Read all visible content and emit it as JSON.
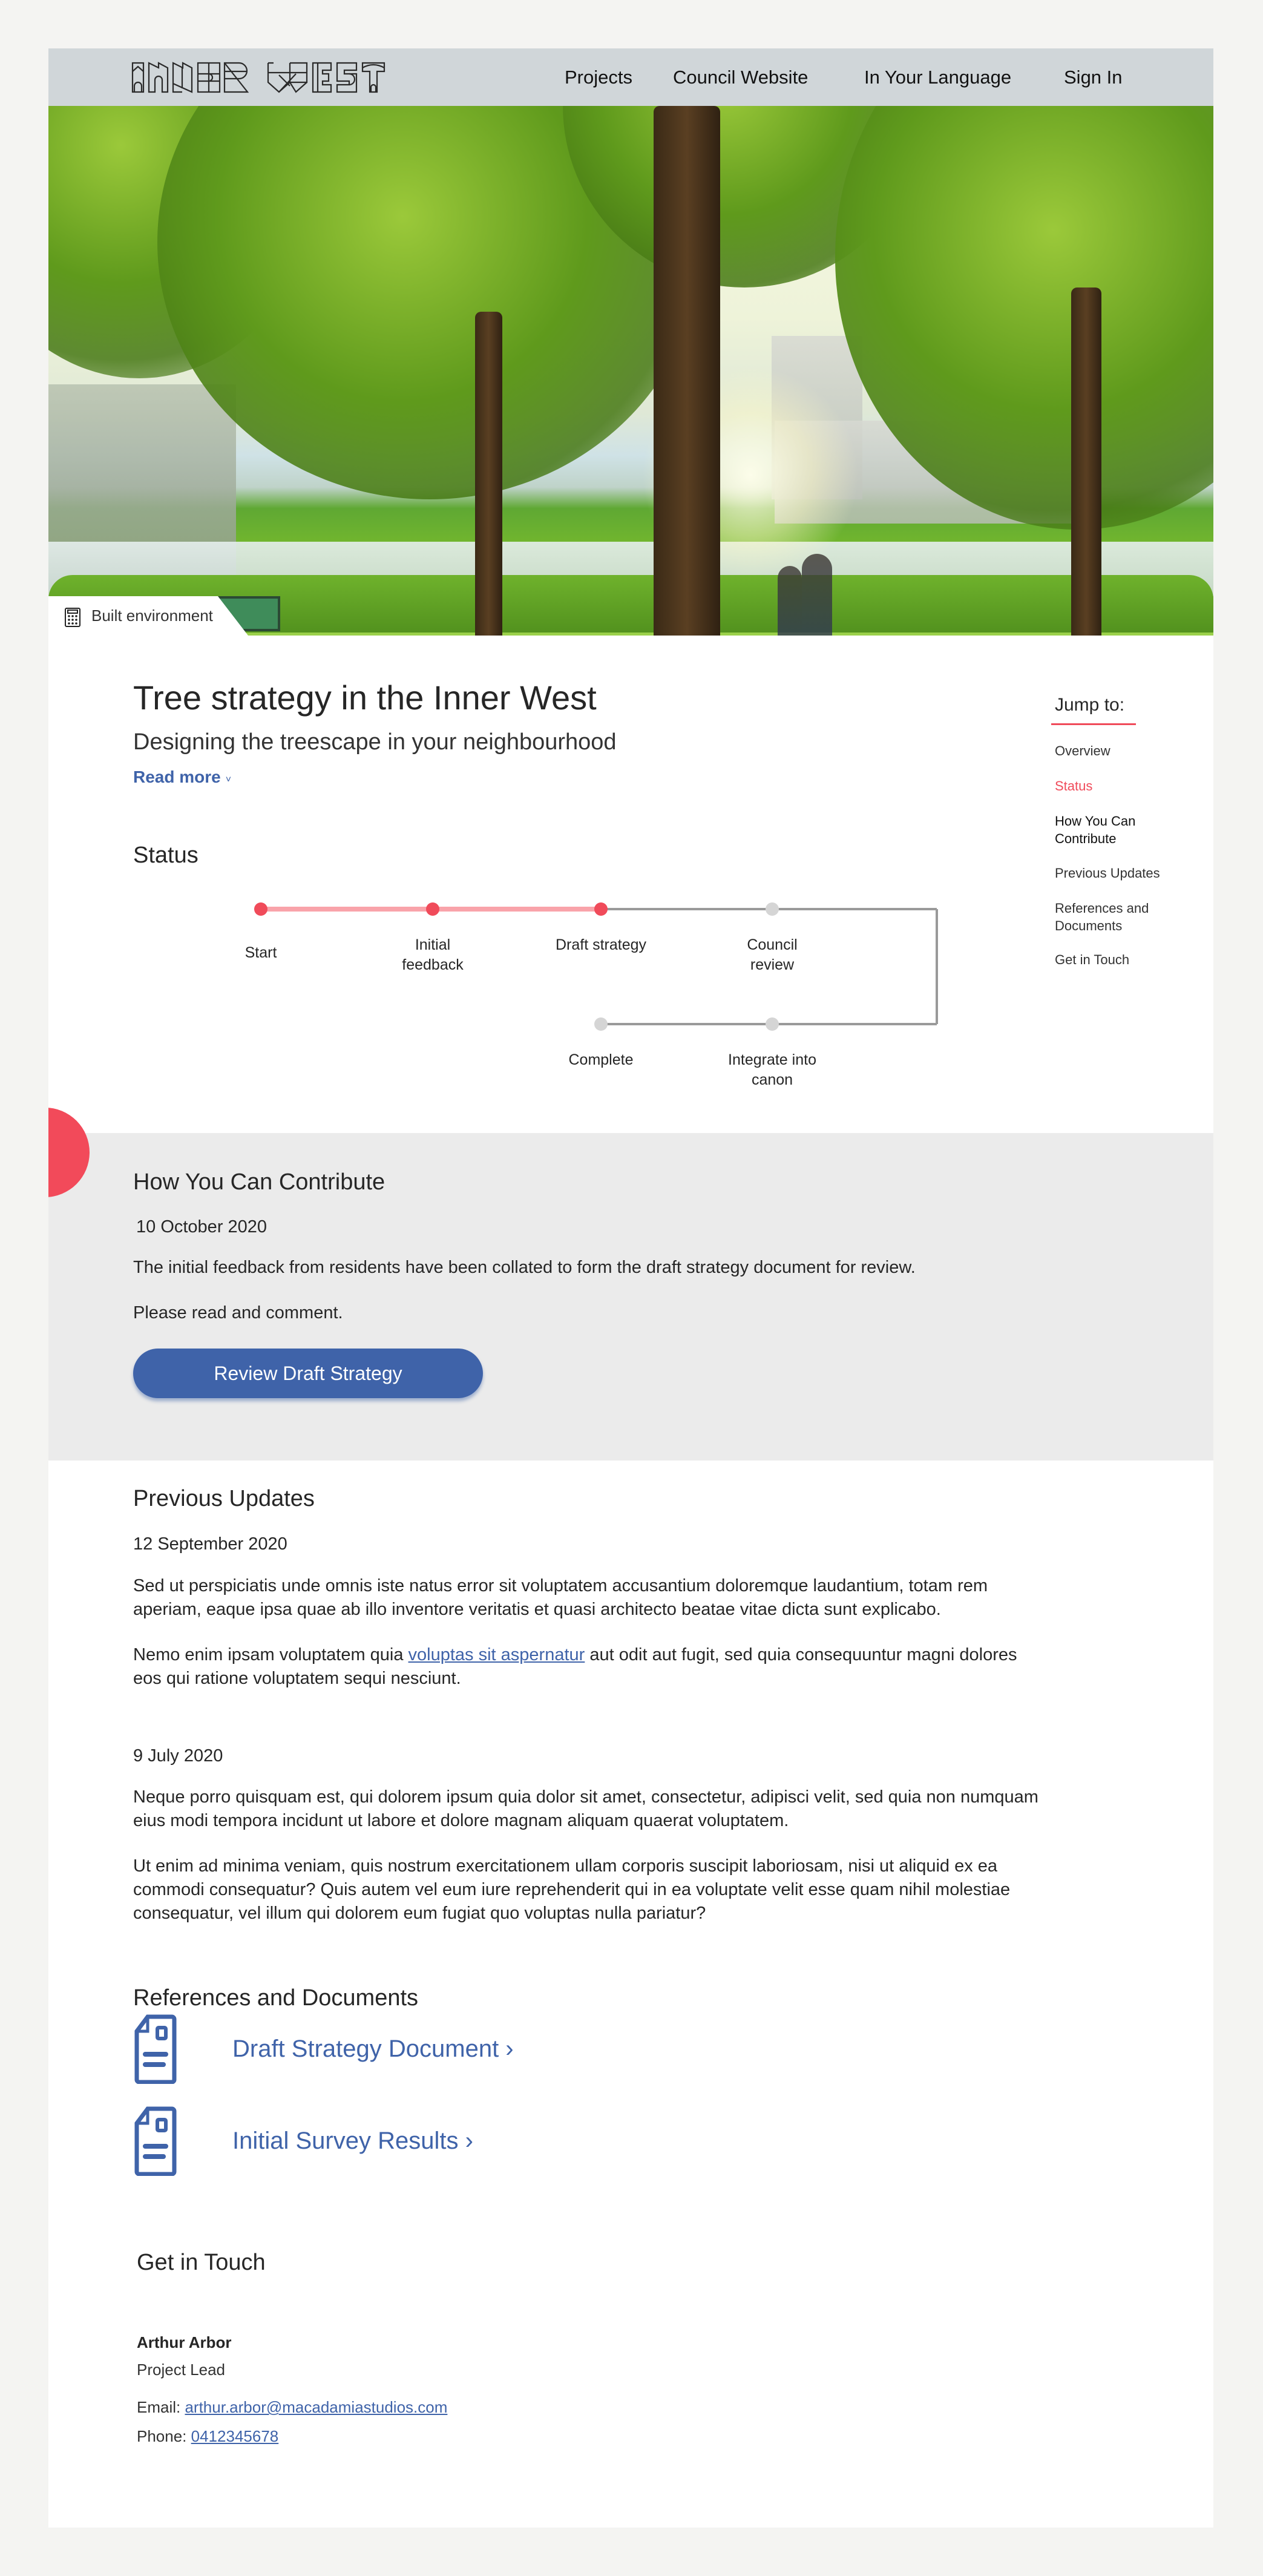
{
  "header": {
    "logo_text": "INNER WEST",
    "nav": [
      {
        "label": "Projects"
      },
      {
        "label": "Council Website"
      },
      {
        "label": "In Your Language"
      },
      {
        "label": "Sign In"
      }
    ]
  },
  "hero": {
    "category_icon": "calculator-icon",
    "category_label": "Built environment"
  },
  "project": {
    "title": "Tree strategy in the Inner West",
    "subtitle": "Designing the treescape in your neighbourhood",
    "read_more": "Read more",
    "read_more_icon": "chevron-down-icon"
  },
  "jump_to": {
    "title": "Jump to:",
    "items": [
      {
        "label": "Overview",
        "state": "default"
      },
      {
        "label": "Status",
        "state": "active"
      },
      {
        "label": "How You Can Contribute",
        "state": "hover"
      },
      {
        "label": "Previous Updates",
        "state": "default"
      },
      {
        "label": "References and Documents",
        "state": "default"
      },
      {
        "label": "Get in Touch",
        "state": "default"
      }
    ]
  },
  "status": {
    "heading": "Status",
    "steps": [
      {
        "label": "Start",
        "done": true
      },
      {
        "label": "Initial feedback",
        "done": true
      },
      {
        "label": "Draft strategy",
        "done": true
      },
      {
        "label": "Council review",
        "done": false
      },
      {
        "label": "Integrate into canon",
        "done": false
      },
      {
        "label": "Complete",
        "done": false
      }
    ],
    "current_step_index": 2,
    "colors": {
      "done": "#f04b5a",
      "done_line": "#f9a3aa",
      "pending": "#d5d5d5",
      "pending_line": "#9a9a9a"
    }
  },
  "contribute": {
    "heading": "How You Can Contribute",
    "date": "10 October 2020",
    "paragraphs": [
      "The initial feedback from residents have been collated to form the draft strategy document for review.",
      "Please read and comment."
    ],
    "button_label": "Review Draft Strategy"
  },
  "updates": {
    "heading": "Previous Updates",
    "entries": [
      {
        "date": "12 September 2020",
        "p1": "Sed ut perspiciatis unde omnis iste natus error sit voluptatem accusantium doloremque laudantium, totam rem aperiam, eaque ipsa quae ab illo inventore veritatis et quasi architecto beatae vitae dicta sunt explicabo.",
        "p2_before": "Nemo enim ipsam voluptatem quia ",
        "p2_link": "voluptas sit aspernatur",
        "p2_after": " aut odit aut fugit, sed quia consequuntur magni dolores eos qui ratione voluptatem sequi nesciunt."
      },
      {
        "date": "9 July 2020",
        "p1": "Neque porro quisquam est, qui dolorem ipsum quia dolor sit amet, consectetur, adipisci velit, sed quia non numquam eius modi tempora incidunt ut labore et dolore magnam aliquam quaerat voluptatem.",
        "p2": "Ut enim ad minima veniam, quis nostrum exercitationem ullam corporis suscipit laboriosam, nisi ut aliquid ex ea commodi consequatur? Quis autem vel eum iure reprehenderit qui in ea voluptate velit esse quam nihil molestiae consequatur, vel illum qui dolorem eum fugiat quo voluptas nulla pariatur?"
      }
    ]
  },
  "documents": {
    "heading": "References and Documents",
    "items": [
      {
        "label": "Draft Strategy Document ›",
        "icon": "document-icon"
      },
      {
        "label": "Initial Survey Results ›",
        "icon": "document-icon"
      }
    ]
  },
  "contact": {
    "heading": "Get in Touch",
    "name": "Arthur Arbor",
    "role": "Project Lead",
    "email_label": "Email: ",
    "email": "arthur.arbor@macadamiastudios.com",
    "phone_label": "Phone: ",
    "phone": "0412345678"
  },
  "colors": {
    "accent_red": "#f04b5a",
    "link_blue": "#3f63a9",
    "header_bg": "#d0d6d9",
    "section_gray": "#ebebeb",
    "page_bg": "#f4f4f2"
  }
}
